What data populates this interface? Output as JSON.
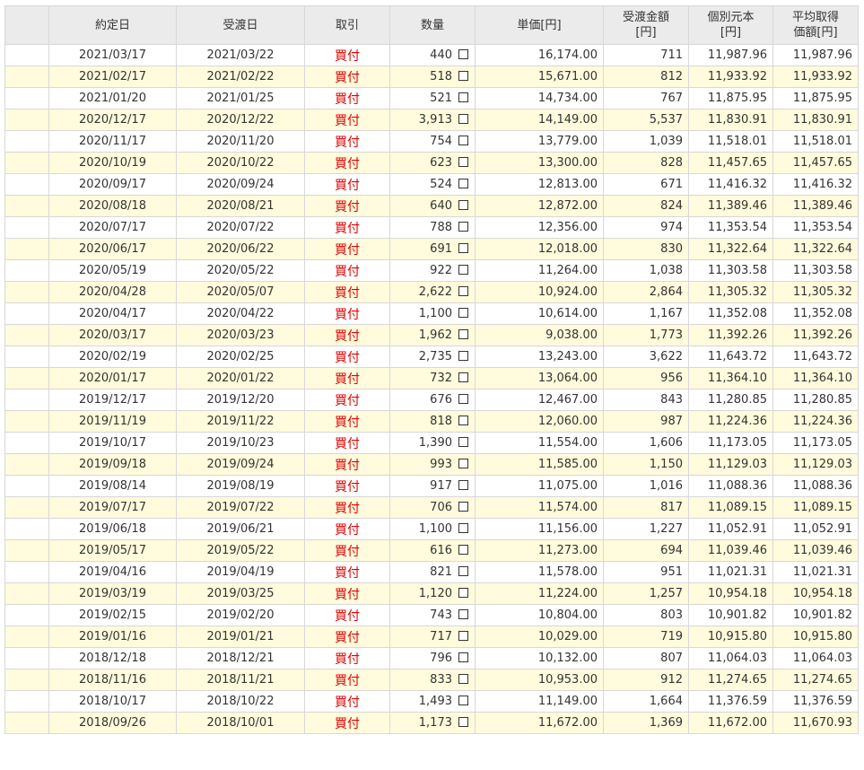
{
  "columns": [
    {
      "line1": "",
      "line2": ""
    },
    {
      "line1": "約定日",
      "line2": ""
    },
    {
      "line1": "受渡日",
      "line2": ""
    },
    {
      "line1": "取引",
      "line2": ""
    },
    {
      "line1": "数量",
      "line2": ""
    },
    {
      "line1": "単価[円]",
      "line2": ""
    },
    {
      "line1": "受渡金額",
      "line2": "[円]"
    },
    {
      "line1": "個別元本",
      "line2": "[円]"
    },
    {
      "line1": "平均取得",
      "line2": "価額[円]"
    }
  ],
  "rows": [
    {
      "trade_date": "2021/03/17",
      "settle_date": "2021/03/22",
      "type": "買付",
      "qty": "440",
      "price": "16,174.00",
      "amount": "711",
      "principal": "11,987.96",
      "avg": "11,987.96"
    },
    {
      "trade_date": "2021/02/17",
      "settle_date": "2021/02/22",
      "type": "買付",
      "qty": "518",
      "price": "15,671.00",
      "amount": "812",
      "principal": "11,933.92",
      "avg": "11,933.92"
    },
    {
      "trade_date": "2021/01/20",
      "settle_date": "2021/01/25",
      "type": "買付",
      "qty": "521",
      "price": "14,734.00",
      "amount": "767",
      "principal": "11,875.95",
      "avg": "11,875.95"
    },
    {
      "trade_date": "2020/12/17",
      "settle_date": "2020/12/22",
      "type": "買付",
      "qty": "3,913",
      "price": "14,149.00",
      "amount": "5,537",
      "principal": "11,830.91",
      "avg": "11,830.91"
    },
    {
      "trade_date": "2020/11/17",
      "settle_date": "2020/11/20",
      "type": "買付",
      "qty": "754",
      "price": "13,779.00",
      "amount": "1,039",
      "principal": "11,518.01",
      "avg": "11,518.01"
    },
    {
      "trade_date": "2020/10/19",
      "settle_date": "2020/10/22",
      "type": "買付",
      "qty": "623",
      "price": "13,300.00",
      "amount": "828",
      "principal": "11,457.65",
      "avg": "11,457.65"
    },
    {
      "trade_date": "2020/09/17",
      "settle_date": "2020/09/24",
      "type": "買付",
      "qty": "524",
      "price": "12,813.00",
      "amount": "671",
      "principal": "11,416.32",
      "avg": "11,416.32"
    },
    {
      "trade_date": "2020/08/18",
      "settle_date": "2020/08/21",
      "type": "買付",
      "qty": "640",
      "price": "12,872.00",
      "amount": "824",
      "principal": "11,389.46",
      "avg": "11,389.46"
    },
    {
      "trade_date": "2020/07/17",
      "settle_date": "2020/07/22",
      "type": "買付",
      "qty": "788",
      "price": "12,356.00",
      "amount": "974",
      "principal": "11,353.54",
      "avg": "11,353.54"
    },
    {
      "trade_date": "2020/06/17",
      "settle_date": "2020/06/22",
      "type": "買付",
      "qty": "691",
      "price": "12,018.00",
      "amount": "830",
      "principal": "11,322.64",
      "avg": "11,322.64"
    },
    {
      "trade_date": "2020/05/19",
      "settle_date": "2020/05/22",
      "type": "買付",
      "qty": "922",
      "price": "11,264.00",
      "amount": "1,038",
      "principal": "11,303.58",
      "avg": "11,303.58"
    },
    {
      "trade_date": "2020/04/28",
      "settle_date": "2020/05/07",
      "type": "買付",
      "qty": "2,622",
      "price": "10,924.00",
      "amount": "2,864",
      "principal": "11,305.32",
      "avg": "11,305.32"
    },
    {
      "trade_date": "2020/04/17",
      "settle_date": "2020/04/22",
      "type": "買付",
      "qty": "1,100",
      "price": "10,614.00",
      "amount": "1,167",
      "principal": "11,352.08",
      "avg": "11,352.08"
    },
    {
      "trade_date": "2020/03/17",
      "settle_date": "2020/03/23",
      "type": "買付",
      "qty": "1,962",
      "price": "9,038.00",
      "amount": "1,773",
      "principal": "11,392.26",
      "avg": "11,392.26"
    },
    {
      "trade_date": "2020/02/19",
      "settle_date": "2020/02/25",
      "type": "買付",
      "qty": "2,735",
      "price": "13,243.00",
      "amount": "3,622",
      "principal": "11,643.72",
      "avg": "11,643.72"
    },
    {
      "trade_date": "2020/01/17",
      "settle_date": "2020/01/22",
      "type": "買付",
      "qty": "732",
      "price": "13,064.00",
      "amount": "956",
      "principal": "11,364.10",
      "avg": "11,364.10"
    },
    {
      "trade_date": "2019/12/17",
      "settle_date": "2019/12/20",
      "type": "買付",
      "qty": "676",
      "price": "12,467.00",
      "amount": "843",
      "principal": "11,280.85",
      "avg": "11,280.85"
    },
    {
      "trade_date": "2019/11/19",
      "settle_date": "2019/11/22",
      "type": "買付",
      "qty": "818",
      "price": "12,060.00",
      "amount": "987",
      "principal": "11,224.36",
      "avg": "11,224.36"
    },
    {
      "trade_date": "2019/10/17",
      "settle_date": "2019/10/23",
      "type": "買付",
      "qty": "1,390",
      "price": "11,554.00",
      "amount": "1,606",
      "principal": "11,173.05",
      "avg": "11,173.05"
    },
    {
      "trade_date": "2019/09/18",
      "settle_date": "2019/09/24",
      "type": "買付",
      "qty": "993",
      "price": "11,585.00",
      "amount": "1,150",
      "principal": "11,129.03",
      "avg": "11,129.03"
    },
    {
      "trade_date": "2019/08/14",
      "settle_date": "2019/08/19",
      "type": "買付",
      "qty": "917",
      "price": "11,075.00",
      "amount": "1,016",
      "principal": "11,088.36",
      "avg": "11,088.36"
    },
    {
      "trade_date": "2019/07/17",
      "settle_date": "2019/07/22",
      "type": "買付",
      "qty": "706",
      "price": "11,574.00",
      "amount": "817",
      "principal": "11,089.15",
      "avg": "11,089.15"
    },
    {
      "trade_date": "2019/06/18",
      "settle_date": "2019/06/21",
      "type": "買付",
      "qty": "1,100",
      "price": "11,156.00",
      "amount": "1,227",
      "principal": "11,052.91",
      "avg": "11,052.91"
    },
    {
      "trade_date": "2019/05/17",
      "settle_date": "2019/05/22",
      "type": "買付",
      "qty": "616",
      "price": "11,273.00",
      "amount": "694",
      "principal": "11,039.46",
      "avg": "11,039.46"
    },
    {
      "trade_date": "2019/04/16",
      "settle_date": "2019/04/19",
      "type": "買付",
      "qty": "821",
      "price": "11,578.00",
      "amount": "951",
      "principal": "11,021.31",
      "avg": "11,021.31"
    },
    {
      "trade_date": "2019/03/19",
      "settle_date": "2019/03/25",
      "type": "買付",
      "qty": "1,120",
      "price": "11,224.00",
      "amount": "1,257",
      "principal": "10,954.18",
      "avg": "10,954.18"
    },
    {
      "trade_date": "2019/02/15",
      "settle_date": "2019/02/20",
      "type": "買付",
      "qty": "743",
      "price": "10,804.00",
      "amount": "803",
      "principal": "10,901.82",
      "avg": "10,901.82"
    },
    {
      "trade_date": "2019/01/16",
      "settle_date": "2019/01/21",
      "type": "買付",
      "qty": "717",
      "price": "10,029.00",
      "amount": "719",
      "principal": "10,915.80",
      "avg": "10,915.80"
    },
    {
      "trade_date": "2018/12/18",
      "settle_date": "2018/12/21",
      "type": "買付",
      "qty": "796",
      "price": "10,132.00",
      "amount": "807",
      "principal": "11,064.03",
      "avg": "11,064.03"
    },
    {
      "trade_date": "2018/11/16",
      "settle_date": "2018/11/21",
      "type": "買付",
      "qty": "833",
      "price": "10,953.00",
      "amount": "912",
      "principal": "11,274.65",
      "avg": "11,274.65"
    },
    {
      "trade_date": "2018/10/17",
      "settle_date": "2018/10/22",
      "type": "買付",
      "qty": "1,493",
      "price": "11,149.00",
      "amount": "1,664",
      "principal": "11,376.59",
      "avg": "11,376.59"
    },
    {
      "trade_date": "2018/09/26",
      "settle_date": "2018/10/01",
      "type": "買付",
      "qty": "1,173",
      "price": "11,672.00",
      "amount": "1,369",
      "principal": "11,672.00",
      "avg": "11,670.93"
    }
  ]
}
